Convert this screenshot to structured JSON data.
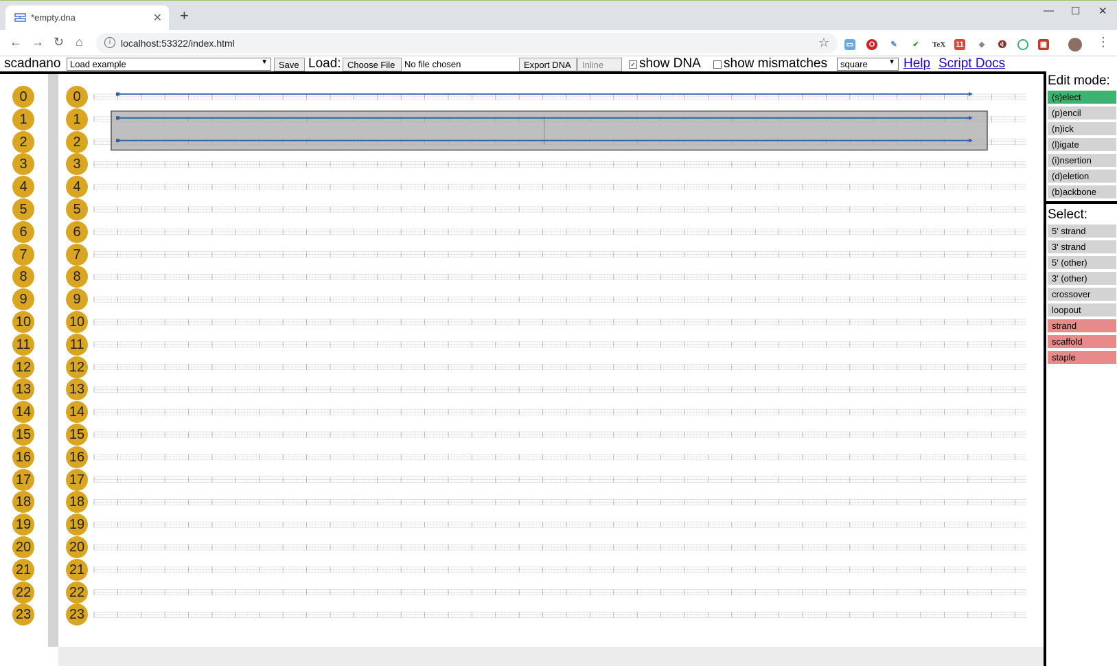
{
  "browser": {
    "tab_title": "*empty.dna",
    "url": "localhost:53322/index.html",
    "ext_badge": "11"
  },
  "menu": {
    "app_name": "scadnano",
    "example_select": "Load example",
    "save": "Save",
    "load_label": "Load:",
    "choose_file": "Choose File",
    "no_file": "No file chosen",
    "export_dna": "Export DNA",
    "inline_id": "Inline I/D",
    "show_dna": "show DNA",
    "show_mismatches": "show mismatches",
    "grid_select": "square",
    "help": "Help",
    "script_docs": "Script Docs"
  },
  "helices": [
    "0",
    "1",
    "2",
    "3",
    "4",
    "5",
    "6",
    "7",
    "8",
    "9",
    "10",
    "11",
    "12",
    "13",
    "14",
    "15",
    "16",
    "17",
    "18",
    "19",
    "20",
    "21",
    "22",
    "23"
  ],
  "edit_mode": {
    "title": "Edit mode:",
    "modes": [
      "(s)elect",
      "(p)encil",
      "(n)ick",
      "(l)igate",
      "(i)nsertion",
      "(d)eletion",
      "(b)ackbone"
    ],
    "active": "(s)elect"
  },
  "select": {
    "title": "Select:",
    "items": [
      "5' strand",
      "3' strand",
      "5' (other)",
      "3' (other)",
      "crossover",
      "loopout",
      "strand",
      "scaffold",
      "staple"
    ],
    "active": [
      "strand",
      "scaffold",
      "staple"
    ]
  },
  "colors": {
    "helix_circle": "#daa520",
    "strand": "#2c5fa8",
    "active_mode": "#3cb371",
    "active_select": "#e88a8a"
  }
}
